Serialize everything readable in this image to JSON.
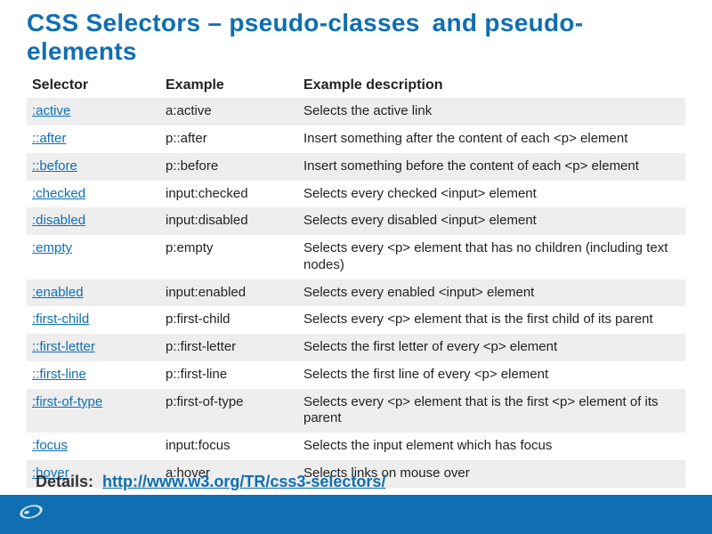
{
  "title_parts": {
    "a": "CSS Selectors – pseudo-classes",
    "b": "and pseudo-elements"
  },
  "columns": {
    "selector": "Selector",
    "example": "Example",
    "desc": "Example description"
  },
  "rows": [
    {
      "selector": ":active",
      "example": "a:active",
      "desc": "Selects the active link"
    },
    {
      "selector": "::after",
      "example": "p::after",
      "desc": "Insert something after the content of each <p> element"
    },
    {
      "selector": "::before",
      "example": "p::before",
      "desc": "Insert something before the content of each <p> element"
    },
    {
      "selector": ":checked",
      "example": "input:checked",
      "desc": "Selects every checked <input> element"
    },
    {
      "selector": ":disabled",
      "example": "input:disabled",
      "desc": "Selects every disabled <input> element"
    },
    {
      "selector": ":empty",
      "example": "p:empty",
      "desc": "Selects every <p> element that has no children (including text nodes)"
    },
    {
      "selector": ":enabled",
      "example": "input:enabled",
      "desc": "Selects every enabled <input> element"
    },
    {
      "selector": ":first-child",
      "example": "p:first-child",
      "desc": "Selects every <p> element that is the first child of its parent"
    },
    {
      "selector": "::first-letter",
      "example": "p::first-letter",
      "desc": "Selects the first letter of every <p> element"
    },
    {
      "selector": "::first-line",
      "example": "p::first-line",
      "desc": "Selects the first line of every <p> element"
    },
    {
      "selector": ":first-of-type",
      "example": "p:first-of-type",
      "desc": "Selects every <p> element that is the first <p> element of its parent"
    },
    {
      "selector": ":focus",
      "example": "input:focus",
      "desc": "Selects the input element which has focus"
    },
    {
      "selector": ":hover",
      "example": "a:hover",
      "desc": "Selects links on mouse over"
    }
  ],
  "details": {
    "label": "Details:",
    "url_text": "http://www.w3.org/TR/css3-selectors/"
  }
}
